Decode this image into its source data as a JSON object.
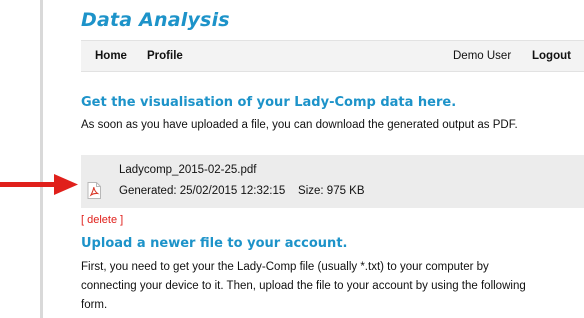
{
  "app": {
    "title": "Data Analysis"
  },
  "nav": {
    "home": "Home",
    "profile": "Profile",
    "user": "Demo User",
    "logout": "Logout"
  },
  "visual": {
    "heading": "Get the visualisation of your Lady-Comp data here.",
    "description": "As soon as you have uploaded a file, you can download the generated output as PDF."
  },
  "file": {
    "name": "Ladycomp_2015-02-25.pdf",
    "generated": "Generated: 25/02/2015 12:32:15    Size: 975 KB",
    "icon": "pdf-file-icon"
  },
  "actions": {
    "delete_label": "[ delete ]"
  },
  "upload": {
    "heading": "Upload a newer file to your account.",
    "lines": [
      "First, you need to get your the Lady-Comp file (usually *.txt) to your computer by",
      "connecting your device to it. Then, upload the file to your account by using the following",
      "form."
    ]
  },
  "colors": {
    "accent": "#1d93c9",
    "danger": "#e0201b",
    "file_box": "#ececec",
    "arrow": "#e0201b"
  }
}
